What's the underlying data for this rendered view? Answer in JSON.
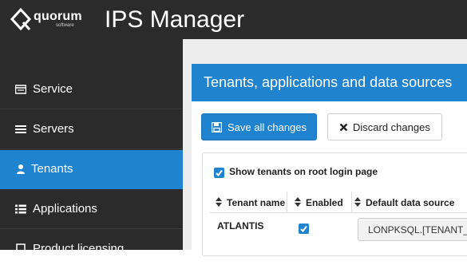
{
  "brand": {
    "name": "quorum",
    "sub": "software"
  },
  "app": {
    "title": "IPS Manager"
  },
  "sidebar": {
    "items": [
      {
        "label": "Service",
        "icon": "server-icon",
        "active": false
      },
      {
        "label": "Servers",
        "icon": "list-icon",
        "active": false
      },
      {
        "label": "Tenants",
        "icon": "user-icon",
        "active": true
      },
      {
        "label": "Applications",
        "icon": "list-icon",
        "active": false
      },
      {
        "label": "Product licensing",
        "icon": "license-icon",
        "active": false
      }
    ]
  },
  "panel": {
    "title": "Tenants, applications and data sources"
  },
  "toolbar": {
    "save_label": "Save all changes",
    "discard_label": "Discard changes"
  },
  "options": {
    "show_tenants_label": "Show tenants on root login page",
    "show_tenants_checked": true
  },
  "table": {
    "headers": [
      "Tenant name",
      "Enabled",
      "Default data source"
    ],
    "rows": [
      {
        "name": "ATLANTIS",
        "enabled": true,
        "data_source": "LONPKSQL.[TENANT_ATLANTIS]"
      }
    ]
  },
  "colors": {
    "accent": "#1f83d0",
    "sidebar_bg": "#2b2b2b",
    "content_bg": "#ededed"
  }
}
